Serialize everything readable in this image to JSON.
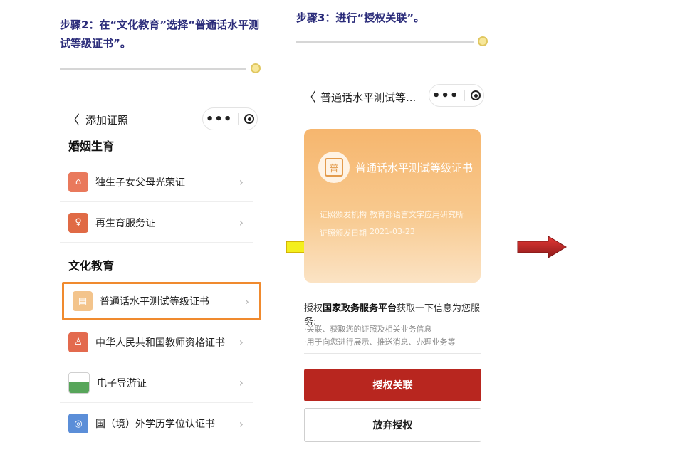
{
  "step2": {
    "title_line1": "步骤2：在“文化教育”选择“普通话水平测",
    "title_line2": "试等级证书”。"
  },
  "step3": {
    "title": "步骤3：进行“授权关联”。"
  },
  "left_phone": {
    "nav": {
      "back_glyph": "〈",
      "title": "添加证照"
    },
    "sections": [
      {
        "title": "婚姻生育",
        "items": [
          {
            "label": "独生子女父母光荣证",
            "chevron": "›"
          },
          {
            "label": "再生育服务证",
            "chevron": "›"
          }
        ]
      },
      {
        "title": "文化教育",
        "items": [
          {
            "label": "普通话水平测试等级证书",
            "chevron": "›"
          },
          {
            "label": "中华人民共和国教师资格证书",
            "chevron": "›"
          },
          {
            "label": "电子导游证",
            "chevron": "›"
          },
          {
            "label": "国（境）外学历学位认证书",
            "chevron": "›"
          }
        ]
      }
    ]
  },
  "right_phone": {
    "nav": {
      "back_glyph": "〈",
      "title": "普通话水平测试等..."
    },
    "card": {
      "badge_glyph": "普",
      "title": "普通话水平测试等级证书",
      "issuer_label": "证照颁发机构",
      "issuer_value": "教育部语言文字应用研究所",
      "date_label": "证照颁发日期",
      "date_value": "2021-03-23"
    },
    "auth": {
      "prefix": "授权",
      "platform": "国家政务服务平台",
      "suffix": "获取一下信息为您服务:",
      "items": [
        "·关联、获取您的证照及相关业务信息",
        "·用于向您进行展示、推送消息、办理业务等"
      ]
    },
    "buttons": {
      "confirm": "授权关联",
      "cancel": "放弃授权"
    }
  },
  "capsule": {
    "dots": "•••"
  },
  "colors": {
    "title_navy": "#2b2c7a",
    "highlight_orange": "#f08a2e",
    "primary_red": "#b8261f",
    "arrow_yellow": "#f4ef1d",
    "arrow_red": "#c62828"
  }
}
